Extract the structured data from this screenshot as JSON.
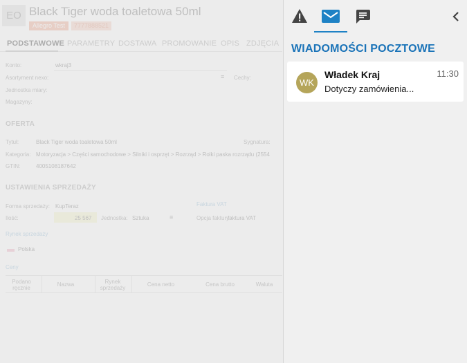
{
  "product": {
    "avatar": "EO",
    "title": "Black Tiger woda toaletowa 50ml",
    "tag_shop": "Allegro Test",
    "tag_id": "7777888521"
  },
  "tabs": [
    "PODSTAWOWE",
    "PARAMETRY",
    "DOSTAWA",
    "PROMOWANIE",
    "OPIS",
    "ZDJĘCIA"
  ],
  "basic": {
    "konto_label": "Konto:",
    "konto_value": "wkraj3",
    "asortyment_label": "Asortyment nexo:",
    "cechy_label": "Cechy:",
    "jednostka_label": "Jednostka miary:",
    "magazyny_label": "Magazyny:"
  },
  "offer": {
    "section": "OFERTA",
    "tytul_label": "Tytuł:",
    "tytul_value": "Black Tiger woda toaletowa 50ml",
    "sygnatura_label": "Sygnatura:",
    "kategoria_label": "Kategoria:",
    "kategoria_value": "Motoryzacja > Części samochodowe > Silniki i osprzęt > Rozrząd > Rolki paska rozrządu (2554",
    "gtin_label": "GTIN:",
    "gtin_value": "4005108187642"
  },
  "sales": {
    "section": "USTAWIENIA SPRZEDAŻY",
    "faktura_link": "Faktura VAT",
    "forma_label": "Forma sprzedaży:",
    "forma_value": "KupTeraz",
    "ilosc_label": "Ilość:",
    "ilosc_value": "25 567",
    "jednostka_label": "Jednostka:",
    "jednostka_value": "Sztuka",
    "opcja_label": "Opcja faktury:",
    "opcja_value": "faktura VAT",
    "rynek_link": "Rynek sprzedaży",
    "rynek_value": "Polska",
    "ceny_link": "Ceny",
    "table_headers": [
      "Podano ręcznie",
      "Nazwa",
      "Rynek sprzedaży",
      "Cena netto",
      "Cena brutto",
      "Waluta"
    ]
  },
  "panel": {
    "title": "WIADOMOŚCI POCZTOWE",
    "messages": [
      {
        "initials": "WK",
        "sender": "Władek Kraj",
        "subject": "Dotyczy zamówienia...",
        "time": "11:30"
      }
    ]
  },
  "colors": {
    "accent": "#1a73b8",
    "tab_underline": "#1e82c5",
    "avatar": "#b5a55a"
  },
  "icons": [
    "warning-icon",
    "mail-icon",
    "chat-icon",
    "chevron-left-icon",
    "menu-icon"
  ]
}
